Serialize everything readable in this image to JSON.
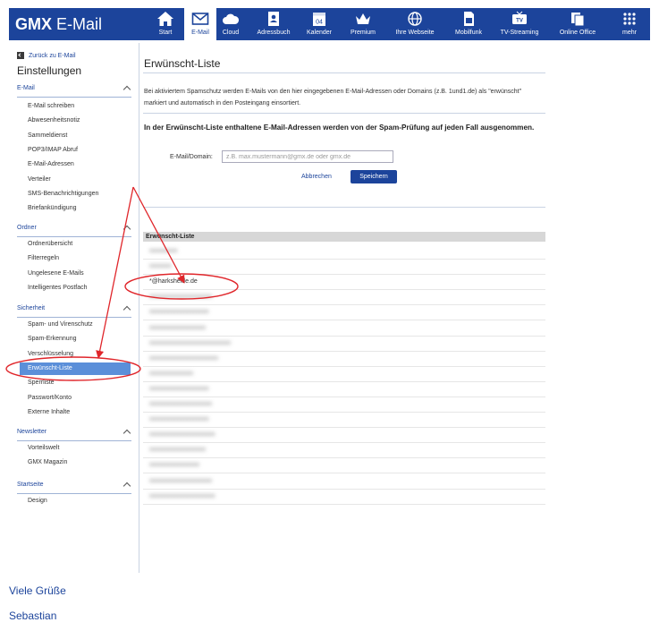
{
  "app": {
    "brand_bold": "GMX",
    "brand_rest": "E-Mail"
  },
  "nav": [
    {
      "label": "Start",
      "icon": "home-icon"
    },
    {
      "label": "E-Mail",
      "icon": "mail-icon",
      "active": true
    },
    {
      "label": "Cloud",
      "icon": "cloud-icon"
    },
    {
      "label": "Adressbuch",
      "icon": "address-book-icon"
    },
    {
      "label": "Kalender",
      "icon": "calendar-icon",
      "badge": "04"
    },
    {
      "label": "Premium",
      "icon": "crown-icon"
    },
    {
      "label": "Ihre Webseite",
      "icon": "globe-icon"
    },
    {
      "label": "Mobilfunk",
      "icon": "sim-card-icon"
    },
    {
      "label": "TV-Streaming",
      "icon": "tv-icon"
    },
    {
      "label": "Online Office",
      "icon": "office-icon"
    },
    {
      "label": "mehr",
      "icon": "grid-icon"
    }
  ],
  "sidebar": {
    "back": "Zurück zu E-Mail",
    "title": "Einstellungen",
    "sections": [
      {
        "title": "E-Mail",
        "items": [
          "E-Mail schreiben",
          "Abwesenheitsnotiz",
          "Sammeldienst",
          "POP3/IMAP Abruf",
          "E-Mail-Adressen",
          "Verteiler",
          "SMS-Benachrichtigungen",
          "Briefankündigung"
        ]
      },
      {
        "title": "Ordner",
        "items": [
          "Ordnerübersicht",
          "Filterregeln",
          "Ungelesene E-Mails",
          "Intelligentes Postfach"
        ]
      },
      {
        "title": "Sicherheit",
        "items": [
          "Spam- und Virenschutz",
          "Spam-Erkennung",
          "Verschlüsselung",
          "Erwünscht-Liste",
          "Sperrliste",
          "Passwort/Konto",
          "Externe Inhalte"
        ],
        "active": "Erwünscht-Liste"
      },
      {
        "title": "Newsletter",
        "items": [
          "Vorteilswelt",
          "GMX Magazin"
        ]
      },
      {
        "title": "Startseite",
        "items": [
          "Design"
        ]
      }
    ]
  },
  "main": {
    "title": "Erwünscht-Liste",
    "description": "Bei aktiviertem Spamschutz werden E-Mails von den hier eingegebenen E-Mail-Adressen oder Domains (z.B. 1und1.de) als \"erwünscht\" markiert und automatisch in den Posteingang einsortiert.",
    "bold_text": "In der Erwünscht-Liste enthaltene E-Mail-Adressen werden von der Spam-Prüfung auf jeden Fall ausgenommen.",
    "field_label": "E-Mail/Domain:",
    "field_placeholder": "z.B. max.mustermann@gmx.de oder gmx.de",
    "cancel_label": "Abbrechen",
    "save_label": "Speichern",
    "list_header": "Erwünscht-Liste",
    "visible_entry": "*@harksheide.de"
  },
  "footer": {
    "line1": "Viele Grüße",
    "line2": "Sebastian"
  },
  "colors": {
    "brand_blue": "#1c449b",
    "active_item": "#5b8fd9",
    "annotation_red": "#e0262b"
  }
}
